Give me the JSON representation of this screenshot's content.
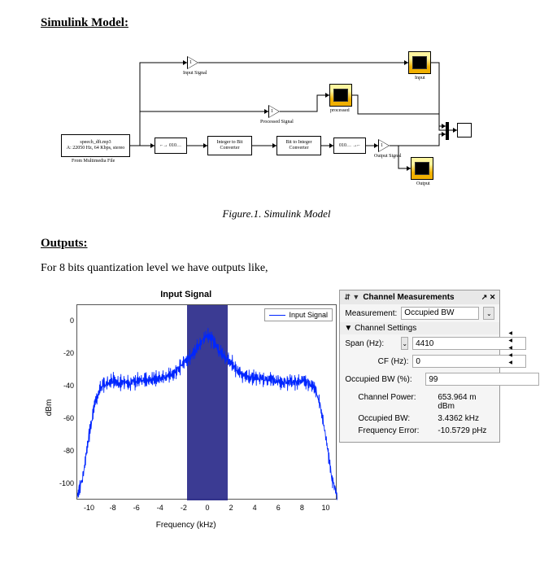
{
  "headings": {
    "model": "Simulink Model:",
    "outputs": "Outputs:"
  },
  "caption": "Figure.1.      Simulink Model",
  "body_text": "For 8 bits quantization level we have outputs like,",
  "simulink": {
    "source_line1": "speech_dft.mp3",
    "source_line2": "A: 22050 Hz, 64 Kbps, stereo",
    "source_label": "From Multimedia File",
    "gain_top": "Input Signal",
    "gain_mid": "Processed Signal",
    "gain_bot": "Output Signal",
    "quant_text": "→ 010…",
    "int2bit": "Integer to Bit Converter",
    "bit2int": "Bit to Integer Converter",
    "dequant_text": "010… →",
    "sink_top": "Input",
    "sink_mid": "processed",
    "sink_bot": "Output"
  },
  "spectrum": {
    "title": "Input Signal",
    "legend": "Input Signal",
    "ylabel": "dBm",
    "xlabel": "Frequency (kHz)",
    "yticks": [
      "0",
      "-20",
      "-40",
      "-60",
      "-80",
      "-100"
    ],
    "xticks": [
      "-10",
      "-8",
      "-6",
      "-4",
      "-2",
      "0",
      "2",
      "4",
      "6",
      "8",
      "10"
    ]
  },
  "meas": {
    "panel_title": "Channel Measurements",
    "measurement_label": "Measurement:",
    "measurement_value": "Occupied BW",
    "settings_header": "Channel Settings",
    "span_label": "Span (Hz):",
    "span_value": "4410",
    "cf_label": "CF (Hz):",
    "cf_value": "0",
    "obw_label": "Occupied BW (%):",
    "obw_value": "99",
    "chpower_label": "Channel Power:",
    "chpower_value": "653.964 m dBm",
    "occbw_label": "Occupied BW:",
    "occbw_value": "3.4362 kHz",
    "ferr_label": "Frequency Error:",
    "ferr_value": "-10.5729 pHz"
  },
  "chart_data": {
    "type": "line",
    "title": "Input Signal",
    "xlabel": "Frequency (kHz)",
    "ylabel": "dBm",
    "ylim": [
      -110,
      10
    ],
    "xlim": [
      -11,
      11
    ],
    "occupied_band_khz": [
      -1.7,
      1.7
    ],
    "series": [
      {
        "name": "Input Signal",
        "x": [
          -11,
          -10.5,
          -10,
          -9.5,
          -9,
          -8.5,
          -8,
          -7.5,
          -7,
          -6.5,
          -6,
          -5.5,
          -5,
          -4.5,
          -4,
          -3.5,
          -3,
          -2.5,
          -2,
          -1.5,
          -1,
          -0.5,
          0,
          0.5,
          1,
          1.5,
          2,
          2.5,
          3,
          3.5,
          4,
          4.5,
          5,
          5.5,
          6,
          6.5,
          7,
          7.5,
          8,
          8.5,
          9,
          9.5,
          10,
          10.5,
          11
        ],
        "y": [
          -108,
          -95,
          -70,
          -50,
          -40,
          -38,
          -36,
          -38,
          -37,
          -38,
          -37,
          -36,
          -36,
          -35,
          -35,
          -34,
          -33,
          -30,
          -25,
          -22,
          -18,
          -12,
          -8,
          -12,
          -18,
          -22,
          -25,
          -30,
          -33,
          -34,
          -35,
          -35,
          -36,
          -36,
          -37,
          -38,
          -37,
          -38,
          -36,
          -38,
          -40,
          -50,
          -70,
          -95,
          -108
        ]
      }
    ]
  }
}
